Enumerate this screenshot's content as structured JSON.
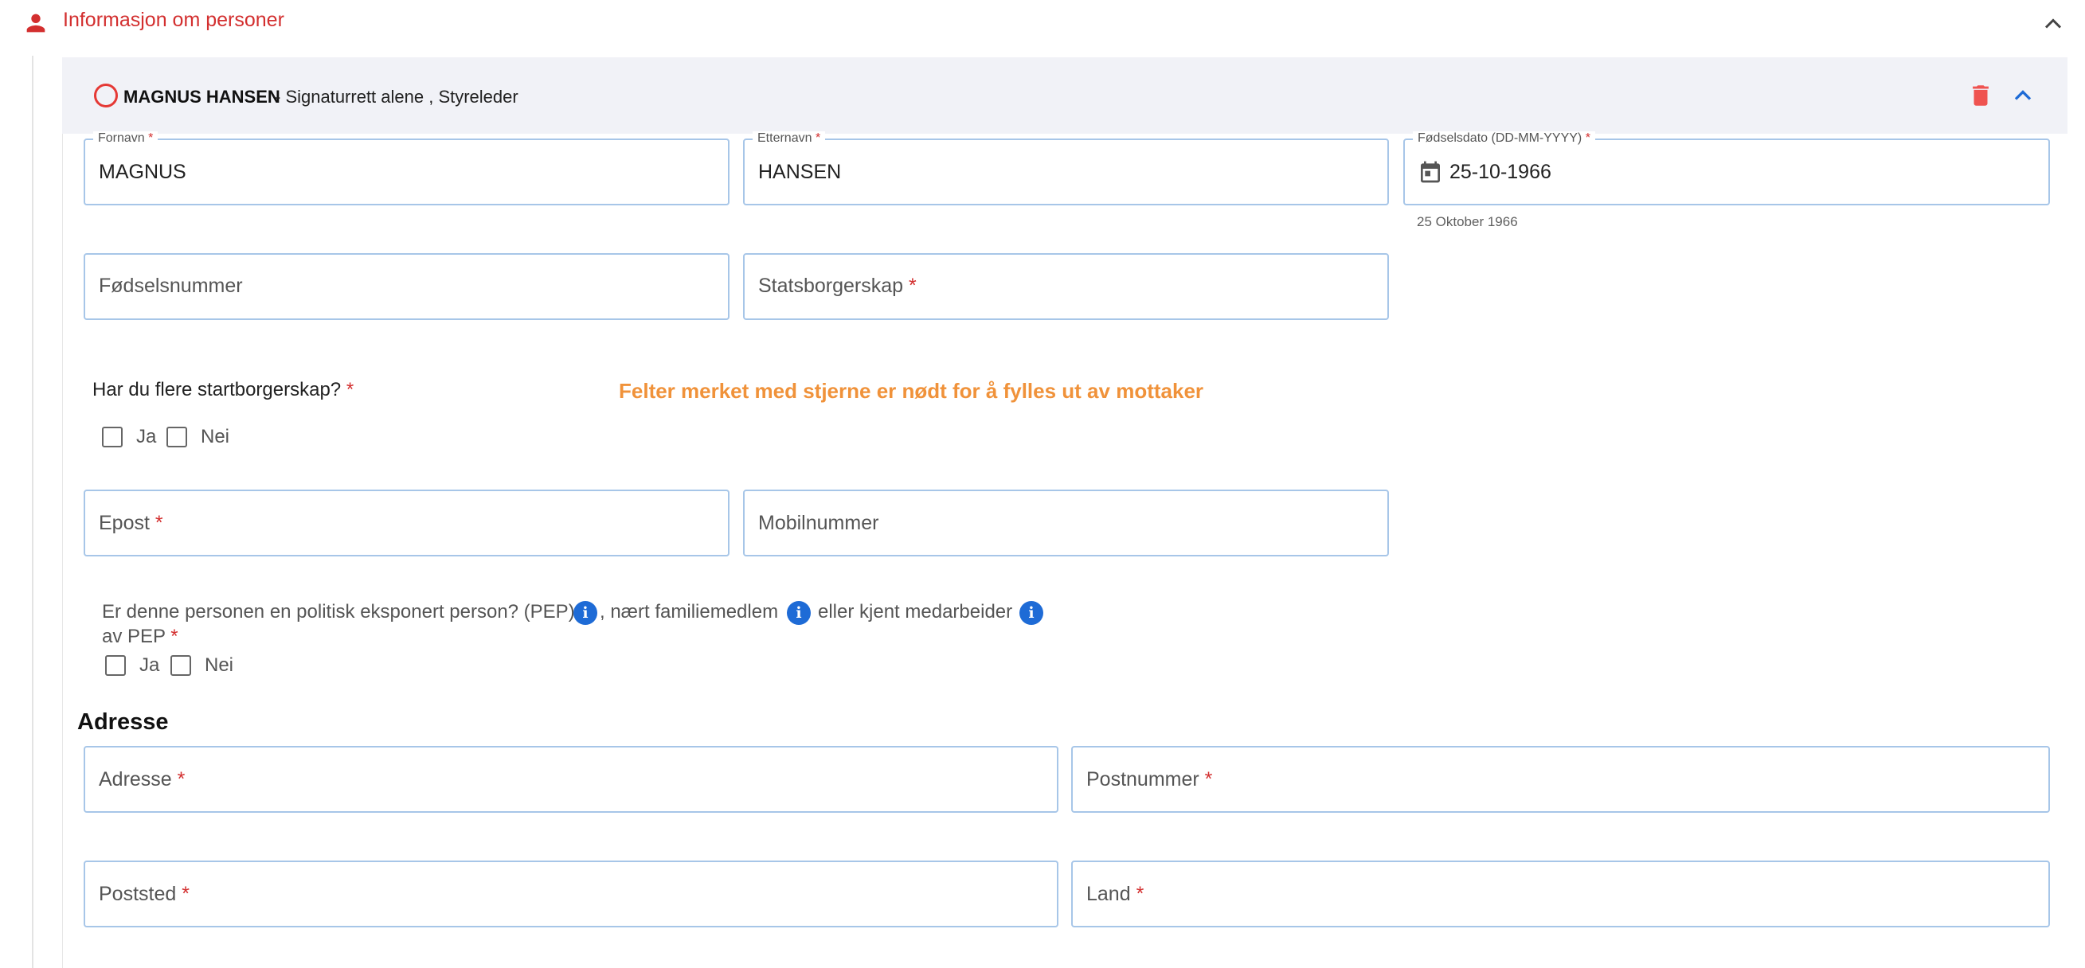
{
  "section": {
    "title": "Informasjon om personer",
    "icon": "person-icon",
    "accent_color": "#d32f2f"
  },
  "person": {
    "name": "MAGNUS HANSEN",
    "roles": "- Signaturrett alene , Styreleder"
  },
  "fields": {
    "fornavn": {
      "label": "Fornavn",
      "value": "MAGNUS"
    },
    "etternavn": {
      "label": "Etternavn",
      "value": "HANSEN"
    },
    "fodselsdato": {
      "label": "Fødselsdato (DD-MM-YYYY)",
      "value": "25-10-1966",
      "helper": "25 Oktober 1966"
    },
    "fodselsnummer": {
      "placeholder": "Fødselsnummer"
    },
    "statsborgerskap": {
      "placeholder": "Statsborgerskap"
    },
    "epost": {
      "placeholder": "Epost"
    },
    "mobilnummer": {
      "placeholder": "Mobilnummer"
    },
    "adresse": {
      "placeholder": "Adresse"
    },
    "postnummer": {
      "placeholder": "Postnummer"
    },
    "poststed": {
      "placeholder": "Poststed"
    },
    "land": {
      "placeholder": "Land"
    }
  },
  "required_marker": "*",
  "citizenship_question": {
    "text": "Har du flere startborgerskap?",
    "options": [
      "Ja",
      "Nei"
    ]
  },
  "notice": "Felter merket med stjerne er nødt for å fylles ut av mottaker",
  "pep_question": {
    "part1": "Er denne personen en politisk eksponert person? (PEP)",
    "part2": ", nært familiemedlem",
    "part3": "eller kjent medarbeider",
    "line2": "av PEP",
    "options": [
      "Ja",
      "Nei"
    ],
    "info_glyph": "i"
  },
  "address_heading": "Adresse"
}
